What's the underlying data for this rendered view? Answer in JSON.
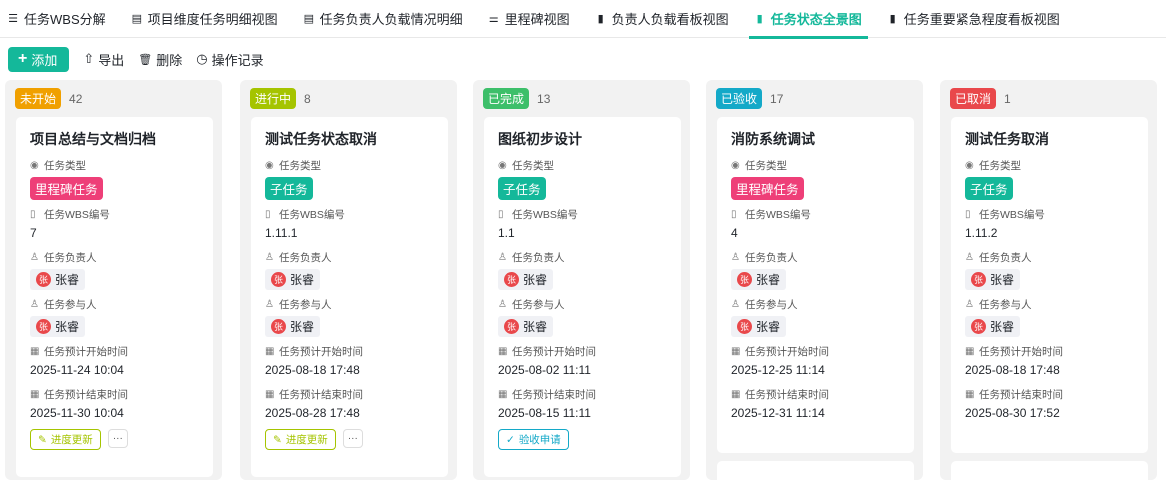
{
  "tabs": [
    {
      "label": "任务WBS分解",
      "icon": "tree-icon",
      "glyph": "☰",
      "active": false
    },
    {
      "label": "项目维度任务明细视图",
      "icon": "table-icon",
      "glyph": "▤",
      "active": false
    },
    {
      "label": "任务负责人负载情况明细",
      "icon": "table-icon",
      "glyph": "▤",
      "active": false
    },
    {
      "label": "里程碑视图",
      "icon": "milestone-icon",
      "glyph": "⚌",
      "active": false
    },
    {
      "label": "负责人负载看板视图",
      "icon": "kanban-icon",
      "glyph": "▮",
      "active": false
    },
    {
      "label": "任务状态全景图",
      "icon": "kanban-icon",
      "glyph": "▮",
      "active": true
    },
    {
      "label": "任务重要紧急程度看板视图",
      "icon": "kanban-icon",
      "glyph": "▮",
      "active": false
    }
  ],
  "toolbar": {
    "add": "添加",
    "export": "导出",
    "delete": "删除",
    "log": "操作记录"
  },
  "fields": {
    "type": "任务类型",
    "wbs": "任务WBS编号",
    "owner": "任务负责人",
    "participants": "任务参与人",
    "start": "任务预计开始时间",
    "end": "任务预计结束时间"
  },
  "colors": {
    "accent": "#14b89a",
    "milestone": "#ee3f78",
    "subtask": "#14b89a"
  },
  "columns": [
    {
      "status": "未开始",
      "color": "#f0a000",
      "count": "42",
      "card": {
        "title": "项目总结与文档归档",
        "type": "里程碑任务",
        "wbs": "7",
        "owner": "张睿",
        "owner_initial": "张",
        "participant": "张睿",
        "participant_initial": "张",
        "start": "2025-11-24 10:04",
        "end": "2025-11-30 10:04",
        "action": "进度更新",
        "action_color": "#a5c400",
        "more": "···"
      }
    },
    {
      "status": "进行中",
      "color": "#a5c400",
      "count": "8",
      "card": {
        "title": "测试任务状态取消",
        "type": "子任务",
        "wbs": "1.11.1",
        "owner": "张睿",
        "owner_initial": "张",
        "participant": "张睿",
        "participant_initial": "张",
        "start": "2025-08-18 17:48",
        "end": "2025-08-28 17:48",
        "action": "进度更新",
        "action_color": "#a5c400",
        "more": "···"
      }
    },
    {
      "status": "已完成",
      "color": "#3dbf6a",
      "count": "13",
      "card": {
        "title": "图纸初步设计",
        "type": "子任务",
        "wbs": "1.1",
        "owner": "张睿",
        "owner_initial": "张",
        "participant": "张睿",
        "participant_initial": "张",
        "start": "2025-08-02 11:11",
        "end": "2025-08-15 11:11",
        "action": "验收申请",
        "action_color": "#14a9c8"
      }
    },
    {
      "status": "已验收",
      "color": "#14a9c8",
      "count": "17",
      "card": {
        "title": "消防系统调试",
        "type": "里程碑任务",
        "wbs": "4",
        "owner": "张睿",
        "owner_initial": "张",
        "participant": "张睿",
        "participant_initial": "张",
        "start": "2025-12-25 11:14",
        "end": "2025-12-31 11:14"
      }
    },
    {
      "status": "已取消",
      "color": "#e9484b",
      "count": "1",
      "card": {
        "title": "测试任务取消",
        "type": "子任务",
        "wbs": "1.11.2",
        "owner": "张睿",
        "owner_initial": "张",
        "participant": "张睿",
        "participant_initial": "张",
        "start": "2025-08-18 17:48",
        "end": "2025-08-30 17:52"
      }
    }
  ]
}
